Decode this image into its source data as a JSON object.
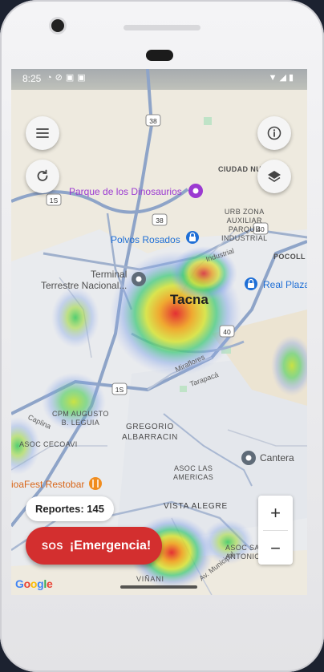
{
  "status_bar": {
    "time": "8:25"
  },
  "map": {
    "labels": {
      "ciudad_nueva": "CIUDAD NUE",
      "parque": "Parque de los Dinosaurios",
      "urb_zona": "URB ZONA\nAUXILIAR\nPARQUE\nINDUSTRIAL",
      "polvos": "Polvos Rosados",
      "pocollay": "POCOLL",
      "industrial": "Industrial",
      "terminal": "Terminal\nTerrestre Nacional...",
      "real_plaza": "Real Plaza",
      "tacna": "Tacna",
      "miraflores": "Miraflores",
      "tarapaca": "Tarapacá",
      "cpm": "CPM AUGUSTO\nB. LEGUIA",
      "caplina": "Caplina",
      "asoc_cecoavi": "ASOC CECOAVI",
      "gregorio": "GREGORIO\nALBARRACIN",
      "asoc_americas": "ASOC LAS\nAMERICAS",
      "cantera": "Cantera",
      "restobar": "ioaFest Restobar",
      "vista_alegre": "VISTA ALEGRE",
      "asoc_san_antonio": "ASOC SAN\nANTONIO",
      "viñani": "VIÑANI",
      "municipal": "Av. Municipal",
      "shield_38a": "38",
      "shield_1s_a": "1S",
      "shield_38b": "38",
      "shield_40a": "40",
      "shield_40b": "40",
      "shield_1s_b": "1S"
    }
  },
  "controls": {
    "reports_label": "Reportes: 145",
    "sos_icon": "SOS",
    "sos_label": "¡Emergencia!",
    "zoom_in": "+",
    "zoom_out": "−",
    "google": "Google"
  },
  "colors": {
    "sos": "#d32f2f",
    "accent_blue": "#1f6fd6",
    "poi_purple": "#9b3ad1"
  },
  "icons": [
    "menu-icon",
    "refresh-icon",
    "info-icon",
    "layers-icon",
    "lock-icon",
    "pin-icon",
    "fork-knife-icon"
  ]
}
